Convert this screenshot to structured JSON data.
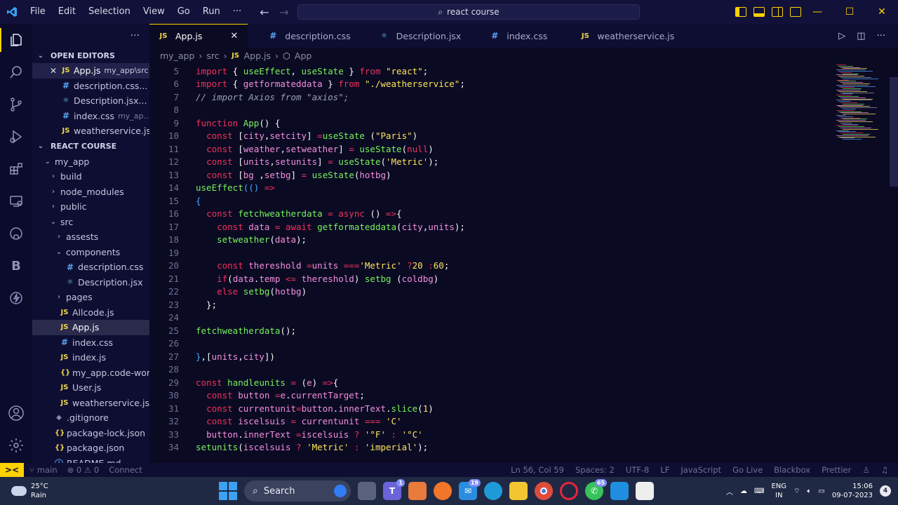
{
  "titlebar": {
    "menu": [
      "File",
      "Edit",
      "Selection",
      "View",
      "Go",
      "Run",
      "···"
    ],
    "search": "react course"
  },
  "colors": {
    "accent": "#ffd200",
    "background": "#0a0a23",
    "keyword": "#f5315c",
    "function": "#78f25a",
    "string": "#ffe55a"
  },
  "sidebar": {
    "open_editors_title": "OPEN EDITORS",
    "open_editors": [
      {
        "name": "App.js",
        "hint": "my_app\\src",
        "type": "js",
        "active": true
      },
      {
        "name": "description.css...",
        "hint": "",
        "type": "css"
      },
      {
        "name": "Description.jsx...",
        "hint": "",
        "type": "jsx"
      },
      {
        "name": "index.css",
        "hint": "my_ap...",
        "type": "css"
      },
      {
        "name": "weatherservice.js...",
        "hint": "",
        "type": "js"
      }
    ],
    "project_title": "REACT COURSE",
    "tree": [
      {
        "name": "my_app",
        "kind": "folder-open",
        "depth": 1
      },
      {
        "name": "build",
        "kind": "folder",
        "depth": 2
      },
      {
        "name": "node_modules",
        "kind": "folder",
        "depth": 2
      },
      {
        "name": "public",
        "kind": "folder",
        "depth": 2
      },
      {
        "name": "src",
        "kind": "folder-open",
        "depth": 2
      },
      {
        "name": "assests",
        "kind": "folder",
        "depth": 3
      },
      {
        "name": "components",
        "kind": "folder-open",
        "depth": 3
      },
      {
        "name": "description.css",
        "kind": "css",
        "depth": 4
      },
      {
        "name": "Description.jsx",
        "kind": "jsx",
        "depth": 4
      },
      {
        "name": "pages",
        "kind": "folder",
        "depth": 3
      },
      {
        "name": "Allcode.js",
        "kind": "js",
        "depth": 3
      },
      {
        "name": "App.js",
        "kind": "js",
        "depth": 3,
        "selected": true
      },
      {
        "name": "index.css",
        "kind": "css",
        "depth": 3
      },
      {
        "name": "index.js",
        "kind": "js",
        "depth": 3
      },
      {
        "name": "my_app.code-work...",
        "kind": "json",
        "depth": 3
      },
      {
        "name": "User.js",
        "kind": "js",
        "depth": 3
      },
      {
        "name": "weatherservice.js",
        "kind": "js",
        "depth": 3
      },
      {
        "name": ".gitignore",
        "kind": "git",
        "depth": 2
      },
      {
        "name": "package-lock.json",
        "kind": "json",
        "depth": 2
      },
      {
        "name": "package.json",
        "kind": "json",
        "depth": 2
      },
      {
        "name": "README.md",
        "kind": "md",
        "depth": 2
      }
    ]
  },
  "tabs": [
    {
      "name": "App.js",
      "type": "js",
      "active": true
    },
    {
      "name": "description.css",
      "type": "css"
    },
    {
      "name": "Description.jsx",
      "type": "jsx"
    },
    {
      "name": "index.css",
      "type": "css"
    },
    {
      "name": "weatherservice.js",
      "type": "js"
    }
  ],
  "breadcrumb": [
    "my_app",
    "src",
    "App.js",
    "App"
  ],
  "code": [
    {
      "n": "5",
      "t": [
        [
          "kw",
          "import"
        ],
        [
          "sv",
          " { "
        ],
        [
          "fn",
          "useEffect"
        ],
        [
          "sv",
          ", "
        ],
        [
          "fn",
          "useState"
        ],
        [
          "sv",
          " } "
        ],
        [
          "kw",
          "from"
        ],
        [
          "sv",
          " "
        ],
        [
          "str",
          "\"react\""
        ],
        [
          "sv",
          ";"
        ]
      ]
    },
    {
      "n": "6",
      "t": [
        [
          "kw",
          "import"
        ],
        [
          "sv",
          " { "
        ],
        [
          "var",
          "getformateddata"
        ],
        [
          "sv",
          " } "
        ],
        [
          "kw",
          "from"
        ],
        [
          "sv",
          " "
        ],
        [
          "str",
          "\"./weatherservice\""
        ],
        [
          "sv",
          ";"
        ]
      ]
    },
    {
      "n": "7",
      "t": [
        [
          "cm",
          "// import Axios from \"axios\";"
        ]
      ]
    },
    {
      "n": "8",
      "t": []
    },
    {
      "n": "9",
      "t": [
        [
          "kw",
          "function"
        ],
        [
          "sv",
          " "
        ],
        [
          "fn",
          "App"
        ],
        [
          "sv",
          "() {"
        ]
      ]
    },
    {
      "n": "10",
      "t": [
        [
          "sv",
          "  "
        ],
        [
          "kw",
          "const"
        ],
        [
          "sv",
          " ["
        ],
        [
          "var",
          "city"
        ],
        [
          "sv",
          ","
        ],
        [
          "var",
          "setcity"
        ],
        [
          "sv",
          "] "
        ],
        [
          "op",
          "="
        ],
        [
          "fn",
          "useState"
        ],
        [
          "sv",
          " ("
        ],
        [
          "str",
          "\"Paris\""
        ],
        [
          "sv",
          ")"
        ]
      ]
    },
    {
      "n": "11",
      "t": [
        [
          "sv",
          "  "
        ],
        [
          "kw",
          "const"
        ],
        [
          "sv",
          " ["
        ],
        [
          "var",
          "weather"
        ],
        [
          "sv",
          ","
        ],
        [
          "var",
          "setweather"
        ],
        [
          "sv",
          "] "
        ],
        [
          "op",
          "="
        ],
        [
          "sv",
          " "
        ],
        [
          "fn",
          "useState"
        ],
        [
          "sv",
          "("
        ],
        [
          "kw",
          "null"
        ],
        [
          "sv",
          ")"
        ]
      ]
    },
    {
      "n": "12",
      "t": [
        [
          "sv",
          "  "
        ],
        [
          "kw",
          "const"
        ],
        [
          "sv",
          " ["
        ],
        [
          "var",
          "units"
        ],
        [
          "sv",
          ","
        ],
        [
          "var",
          "setunits"
        ],
        [
          "sv",
          "] "
        ],
        [
          "op",
          "="
        ],
        [
          "sv",
          " "
        ],
        [
          "fn",
          "useState"
        ],
        [
          "sv",
          "("
        ],
        [
          "str",
          "'Metric'"
        ],
        [
          "sv",
          ");"
        ]
      ]
    },
    {
      "n": "13",
      "t": [
        [
          "sv",
          "  "
        ],
        [
          "kw",
          "const"
        ],
        [
          "sv",
          " ["
        ],
        [
          "var",
          "bg"
        ],
        [
          "sv",
          " ,"
        ],
        [
          "var",
          "setbg"
        ],
        [
          "sv",
          "] "
        ],
        [
          "op",
          "="
        ],
        [
          "sv",
          " "
        ],
        [
          "fn",
          "useState"
        ],
        [
          "sv",
          "("
        ],
        [
          "var",
          "hotbg"
        ],
        [
          "sv",
          ")"
        ]
      ]
    },
    {
      "n": "14",
      "t": [
        [
          "fn",
          "useEffect"
        ],
        [
          "br",
          "(() "
        ],
        [
          "op",
          "=>"
        ]
      ]
    },
    {
      "n": "15",
      "t": [
        [
          "br",
          "{"
        ]
      ]
    },
    {
      "n": "16",
      "t": [
        [
          "sv",
          "  "
        ],
        [
          "kw",
          "const"
        ],
        [
          "sv",
          " "
        ],
        [
          "fn",
          "fetchweatherdata"
        ],
        [
          "sv",
          " "
        ],
        [
          "op",
          "="
        ],
        [
          "sv",
          " "
        ],
        [
          "kw",
          "async"
        ],
        [
          "sv",
          " () "
        ],
        [
          "op",
          "=>"
        ],
        [
          "sv",
          "{"
        ]
      ]
    },
    {
      "n": "17",
      "t": [
        [
          "sv",
          "    "
        ],
        [
          "kw",
          "const"
        ],
        [
          "sv",
          " "
        ],
        [
          "var",
          "data"
        ],
        [
          "sv",
          " "
        ],
        [
          "op",
          "="
        ],
        [
          "sv",
          " "
        ],
        [
          "kw",
          "await"
        ],
        [
          "sv",
          " "
        ],
        [
          "fn",
          "getformateddata"
        ],
        [
          "sv",
          "("
        ],
        [
          "var",
          "city"
        ],
        [
          "sv",
          ","
        ],
        [
          "var",
          "units"
        ],
        [
          "sv",
          ");"
        ]
      ]
    },
    {
      "n": "18",
      "t": [
        [
          "sv",
          "    "
        ],
        [
          "fn",
          "setweather"
        ],
        [
          "sv",
          "("
        ],
        [
          "var",
          "data"
        ],
        [
          "sv",
          ");"
        ]
      ]
    },
    {
      "n": "19",
      "t": []
    },
    {
      "n": "20",
      "t": [
        [
          "sv",
          "    "
        ],
        [
          "kw",
          "const"
        ],
        [
          "sv",
          " "
        ],
        [
          "var",
          "thereshold"
        ],
        [
          "sv",
          " "
        ],
        [
          "op",
          "="
        ],
        [
          "var",
          "units"
        ],
        [
          "sv",
          " "
        ],
        [
          "op",
          "==="
        ],
        [
          "str",
          "'Metric'"
        ],
        [
          "sv",
          " "
        ],
        [
          "op",
          "?"
        ],
        [
          "str",
          "20"
        ],
        [
          "sv",
          " "
        ],
        [
          "op",
          ":"
        ],
        [
          "str",
          "60"
        ],
        [
          "sv",
          ";"
        ]
      ]
    },
    {
      "n": "21",
      "t": [
        [
          "sv",
          "    "
        ],
        [
          "kw",
          "if"
        ],
        [
          "sv",
          "("
        ],
        [
          "var",
          "data"
        ],
        [
          "sv",
          "."
        ],
        [
          "var",
          "temp"
        ],
        [
          "sv",
          " "
        ],
        [
          "op",
          "<="
        ],
        [
          "sv",
          " "
        ],
        [
          "var",
          "thereshold"
        ],
        [
          "sv",
          ") "
        ],
        [
          "fn",
          "setbg"
        ],
        [
          "sv",
          " ("
        ],
        [
          "var",
          "coldbg"
        ],
        [
          "sv",
          ")"
        ]
      ]
    },
    {
      "n": "22",
      "t": [
        [
          "sv",
          "    "
        ],
        [
          "kw",
          "else"
        ],
        [
          "sv",
          " "
        ],
        [
          "fn",
          "setbg"
        ],
        [
          "sv",
          "("
        ],
        [
          "var",
          "hotbg"
        ],
        [
          "sv",
          ")"
        ]
      ]
    },
    {
      "n": "23",
      "t": [
        [
          "sv",
          "  };"
        ]
      ]
    },
    {
      "n": "24",
      "t": []
    },
    {
      "n": "25",
      "t": [
        [
          "fn",
          "fetchweatherdata"
        ],
        [
          "sv",
          "();"
        ]
      ]
    },
    {
      "n": "26",
      "t": []
    },
    {
      "n": "27",
      "t": [
        [
          "br",
          "}"
        ],
        [
          "sv",
          ",["
        ],
        [
          "var",
          "units"
        ],
        [
          "sv",
          ","
        ],
        [
          "var",
          "city"
        ],
        [
          "sv",
          "])"
        ]
      ]
    },
    {
      "n": "28",
      "t": []
    },
    {
      "n": "29",
      "t": [
        [
          "kw",
          "const"
        ],
        [
          "sv",
          " "
        ],
        [
          "fn",
          "handleunits"
        ],
        [
          "sv",
          " "
        ],
        [
          "op",
          "="
        ],
        [
          "sv",
          " ("
        ],
        [
          "var",
          "e"
        ],
        [
          "sv",
          ") "
        ],
        [
          "op",
          "=>"
        ],
        [
          "sv",
          "{"
        ]
      ]
    },
    {
      "n": "30",
      "t": [
        [
          "sv",
          "  "
        ],
        [
          "kw",
          "const"
        ],
        [
          "sv",
          " "
        ],
        [
          "var",
          "button"
        ],
        [
          "sv",
          " "
        ],
        [
          "op",
          "="
        ],
        [
          "var",
          "e"
        ],
        [
          "sv",
          "."
        ],
        [
          "var",
          "currentTarget"
        ],
        [
          "sv",
          ";"
        ]
      ]
    },
    {
      "n": "31",
      "t": [
        [
          "sv",
          "  "
        ],
        [
          "kw",
          "const"
        ],
        [
          "sv",
          " "
        ],
        [
          "var",
          "currentunit"
        ],
        [
          "op",
          "="
        ],
        [
          "var",
          "button"
        ],
        [
          "sv",
          "."
        ],
        [
          "var",
          "innerText"
        ],
        [
          "sv",
          "."
        ],
        [
          "fn",
          "slice"
        ],
        [
          "sv",
          "("
        ],
        [
          "str",
          "1"
        ],
        [
          "sv",
          ")"
        ]
      ]
    },
    {
      "n": "32",
      "t": [
        [
          "sv",
          "  "
        ],
        [
          "kw",
          "const"
        ],
        [
          "sv",
          " "
        ],
        [
          "var",
          "iscelsuis"
        ],
        [
          "sv",
          " "
        ],
        [
          "op",
          "="
        ],
        [
          "sv",
          " "
        ],
        [
          "var",
          "currentunit"
        ],
        [
          "sv",
          " "
        ],
        [
          "op",
          "==="
        ],
        [
          "sv",
          " "
        ],
        [
          "str",
          "'C'"
        ]
      ]
    },
    {
      "n": "33",
      "t": [
        [
          "sv",
          "  "
        ],
        [
          "var",
          "button"
        ],
        [
          "sv",
          "."
        ],
        [
          "var",
          "innerText"
        ],
        [
          "sv",
          " "
        ],
        [
          "op",
          "="
        ],
        [
          "var",
          "iscelsuis"
        ],
        [
          "sv",
          " "
        ],
        [
          "op",
          "?"
        ],
        [
          "sv",
          " "
        ],
        [
          "str",
          "'°F'"
        ],
        [
          "sv",
          " "
        ],
        [
          "op",
          ":"
        ],
        [
          "sv",
          " "
        ],
        [
          "str",
          "'°C'"
        ]
      ]
    },
    {
      "n": "34",
      "t": [
        [
          "fn",
          "setunits"
        ],
        [
          "sv",
          "("
        ],
        [
          "var",
          "iscelsuis"
        ],
        [
          "sv",
          " "
        ],
        [
          "op",
          "?"
        ],
        [
          "sv",
          " "
        ],
        [
          "str",
          "'Metric'"
        ],
        [
          "sv",
          " "
        ],
        [
          "op",
          ":"
        ],
        [
          "sv",
          " "
        ],
        [
          "str",
          "'imperial'"
        ],
        [
          "sv",
          ");"
        ]
      ]
    }
  ],
  "statusbar": {
    "remote": "><",
    "branch": "main",
    "problems": "⊗ 0 ⚠ 0",
    "connect": "Connect",
    "position": "Ln 56, Col 59",
    "spaces": "Spaces: 2",
    "encoding": "UTF-8",
    "eol": "LF",
    "language": "JavaScript",
    "golive": "Go Live",
    "blackbox": "Blackbox",
    "prettier": "Prettier"
  },
  "taskbar": {
    "temp": "25°C",
    "condition": "Rain",
    "search": "Search",
    "lang1": "ENG",
    "lang2": "IN",
    "time": "15:06",
    "date": "09-07-2023",
    "notifications": "4",
    "badge_teams": "1",
    "badge_mail": "19",
    "badge_whatsapp": "65"
  }
}
